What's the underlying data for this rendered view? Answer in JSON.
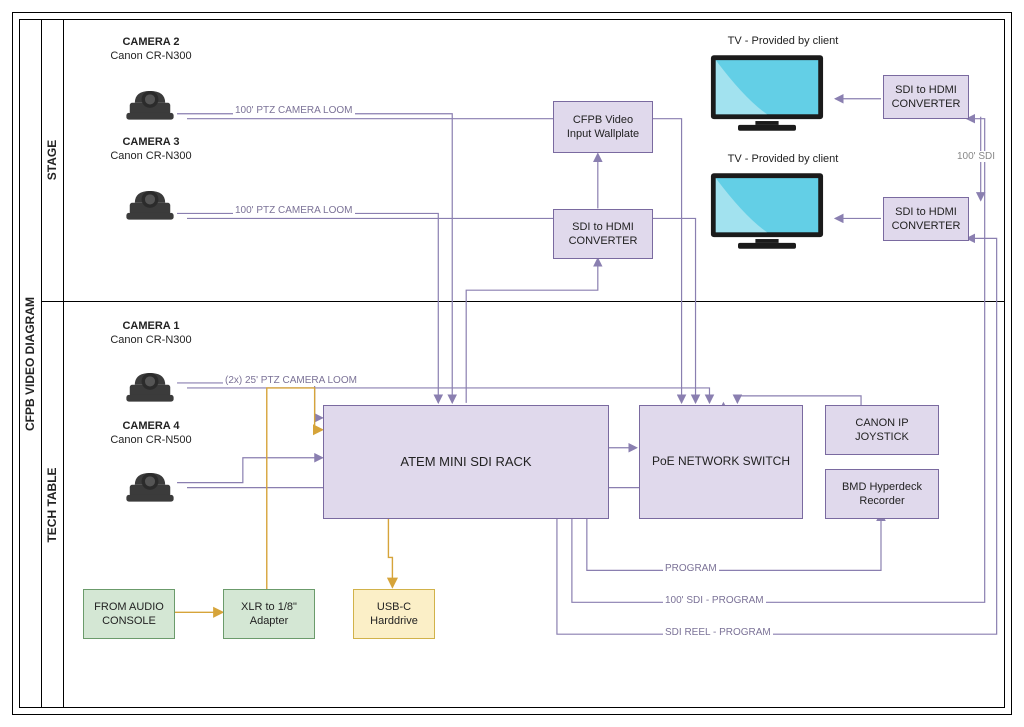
{
  "diagram_title": "CFPB VIDEO DIAGRAM",
  "sections": {
    "stage": "STAGE",
    "tech": "TECH TABLE"
  },
  "cameras": {
    "cam1": {
      "title": "CAMERA 1",
      "model": "Canon CR-N300"
    },
    "cam2": {
      "title": "CAMERA 2",
      "model": "Canon CR-N300"
    },
    "cam3": {
      "title": "CAMERA 3",
      "model": "Canon CR-N300"
    },
    "cam4": {
      "title": "CAMERA 4",
      "model": "Canon CR-N500"
    }
  },
  "boxes": {
    "wallplate": "CFPB Video Input Wallplate",
    "sdi_hdmi_a": "SDI to HDMI CONVERTER",
    "sdi_hdmi_b": "SDI to HDMI CONVERTER",
    "sdi_hdmi_c": "SDI to HDMI CONVERTER",
    "atem": "ATEM MINI SDI RACK",
    "poe": "PoE NETWORK SWITCH",
    "joystick": "CANON IP JOYSTICK",
    "hyperdeck": "BMD Hyperdeck Recorder",
    "audio": "FROM AUDIO CONSOLE",
    "xlr": "XLR to 1/8\" Adapter",
    "usbc": "USB-C Harddrive"
  },
  "labels": {
    "tv_client": "TV - Provided by client",
    "ptz100": "100' PTZ CAMERA LOOM",
    "ptz25": "(2x) 25' PTZ CAMERA LOOM",
    "sdi100": "100' SDI",
    "program": "PROGRAM",
    "sdi100_prog": "100' SDI - PROGRAM",
    "sdi_reel_prog": "SDI REEL - PROGRAM"
  }
}
